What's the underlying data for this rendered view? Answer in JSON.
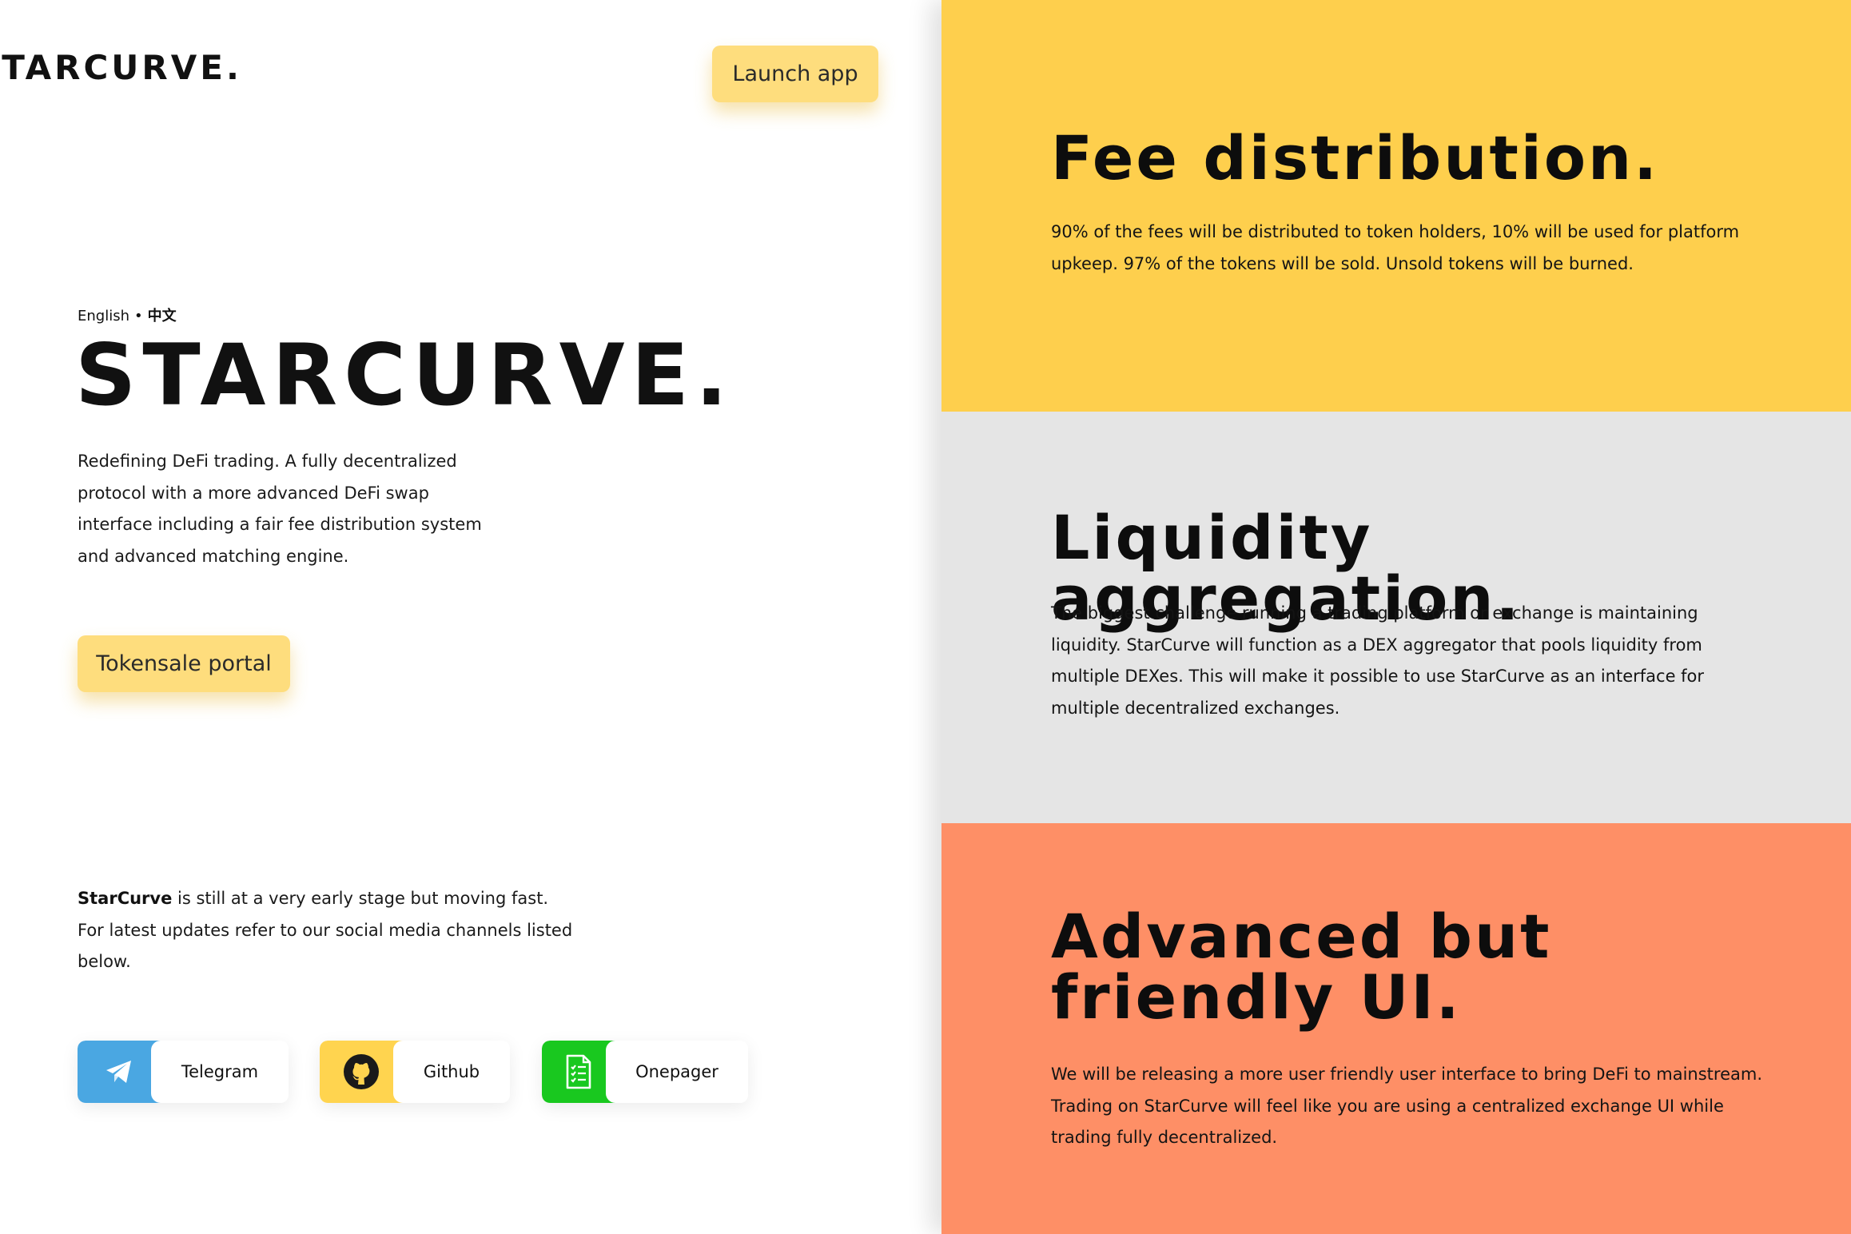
{
  "header": {
    "logo_text": "STARCURVE.",
    "launch_label": "Launch app"
  },
  "hero": {
    "lang_en": "English",
    "lang_sep": "•",
    "lang_zh": "中文",
    "title": "STARCURVE.",
    "description": "Redefining DeFi trading. A fully decentralized protocol with a more advanced DeFi swap interface including a fair fee distribution system and advanced matching engine.",
    "tokensale_label": "Tokensale portal"
  },
  "updates": {
    "brand": "StarCurve",
    "text": " is still at a very early stage but moving fast. For latest updates refer to our social media channels listed below."
  },
  "social": [
    {
      "label": "Telegram",
      "icon": "telegram-icon",
      "color": "#4aa7e2"
    },
    {
      "label": "Github",
      "icon": "github-icon",
      "color": "#ffd44f"
    },
    {
      "label": "Onepager",
      "icon": "document-icon",
      "color": "#19c81f"
    }
  ],
  "features": [
    {
      "title": "Fee distribution.",
      "text": "90% of the fees will be distributed to token holders, 10% will be used for platform upkeep. 97% of the tokens will be sold. Unsold tokens will be burned.",
      "color": "#fecf4d"
    },
    {
      "title": "Liquidity aggregation.",
      "text": "The biggest challenge running a trading platform or exchange is maintaining liquidity. StarCurve will function as a DEX aggregator that pools liquidity from multiple DEXes. This will make it possible to use StarCurve as an interface for multiple decentralized exchanges.",
      "color": "#e5e5e5"
    },
    {
      "title": "Advanced but friendly UI.",
      "text": "We will be releasing a more user friendly user interface to bring DeFi to mainstream. Trading on StarCurve will feel like you are using a centralized exchange UI while trading fully decentralized.",
      "color": "#fe8f66"
    }
  ],
  "colors": {
    "button_yellow": "#fedd7d",
    "text": "#111111"
  }
}
